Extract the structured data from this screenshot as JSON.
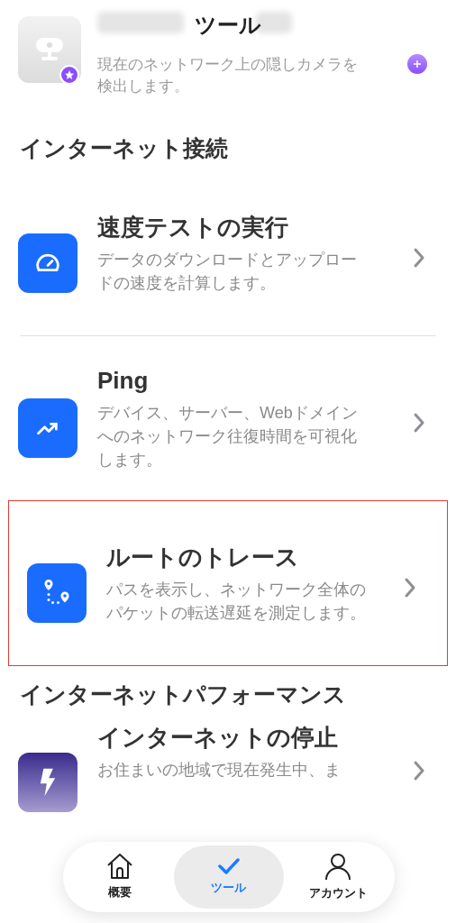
{
  "header": {
    "title": "ツール"
  },
  "top_item": {
    "description": "現在のネットワーク上の隠しカメラを検出します。",
    "kind": "premium"
  },
  "sections": [
    {
      "title": "インターネット接続",
      "items": [
        {
          "title": "速度テストの実行",
          "description": "データのダウンロードとアップロードの速度を計算します。",
          "highlighted": false
        },
        {
          "title": "Ping",
          "description": "デバイス、サーバー、Webドメインへのネットワーク往復時間を可視化します。",
          "highlighted": false
        },
        {
          "title": "ルートのトレース",
          "description": "パスを表示し、ネットワーク全体のパケットの転送遅延を測定します。",
          "highlighted": true
        }
      ]
    },
    {
      "title": "インターネットパフォーマンス",
      "items": [
        {
          "title": "インターネットの停止",
          "description": "お住まいの地域で現在発生中、ま",
          "highlighted": false
        }
      ]
    }
  ],
  "tab_bar": [
    {
      "label": "概要",
      "selected": false
    },
    {
      "label": "ツール",
      "selected": true
    },
    {
      "label": "アカウント",
      "selected": false
    }
  ]
}
